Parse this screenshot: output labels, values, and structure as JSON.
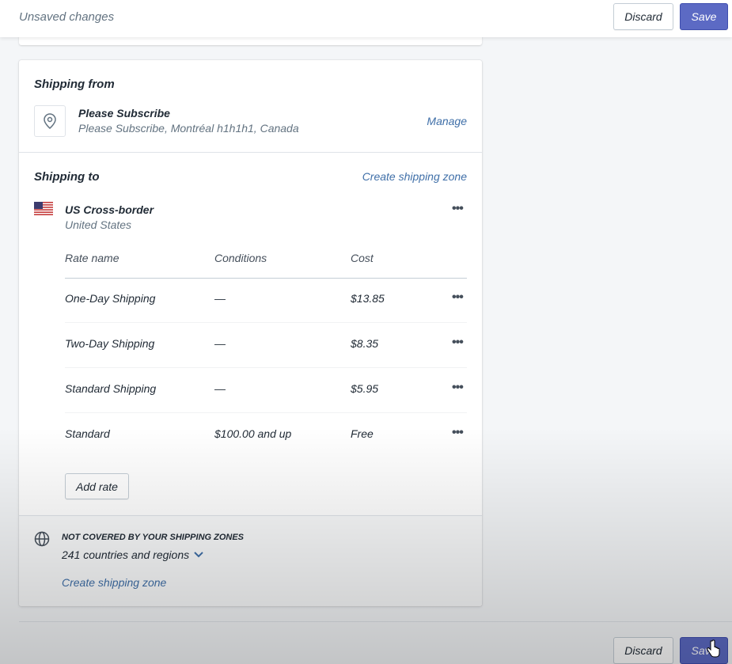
{
  "topbar": {
    "title": "Unsaved changes",
    "discard": "Discard",
    "save": "Save"
  },
  "shipping_from": {
    "heading": "Shipping from",
    "location_name": "Please Subscribe",
    "address": "Please Subscribe, Montréal h1h1h1, Canada",
    "manage": "Manage"
  },
  "shipping_to": {
    "heading": "Shipping to",
    "create_zone": "Create shipping zone",
    "zone": {
      "name": "US Cross-border",
      "country": "United States",
      "flag_icon": "us-flag-icon"
    },
    "columns": [
      "Rate name",
      "Conditions",
      "Cost"
    ],
    "rates": [
      {
        "name": "One-Day Shipping",
        "conditions": "—",
        "cost": "$13.85"
      },
      {
        "name": "Two-Day Shipping",
        "conditions": "—",
        "cost": "$8.35"
      },
      {
        "name": "Standard Shipping",
        "conditions": "—",
        "cost": "$5.95"
      },
      {
        "name": "Standard",
        "conditions": "$100.00 and up",
        "cost": "Free"
      }
    ],
    "add_rate": "Add rate"
  },
  "not_covered": {
    "heading": "NOT COVERED BY YOUR SHIPPING ZONES",
    "count": "241 countries and regions",
    "create_zone": "Create shipping zone"
  },
  "bottombar": {
    "discard": "Discard",
    "save": "Save"
  },
  "colors": {
    "primary": "#5c6ac4",
    "link": "#3f6fa8",
    "background": "#f4f6f8"
  }
}
